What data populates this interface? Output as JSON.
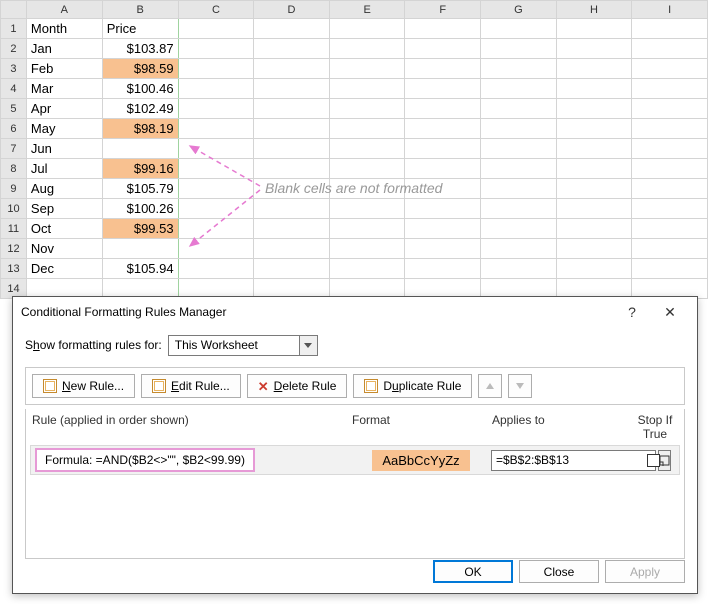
{
  "columns": [
    "A",
    "B",
    "C",
    "D",
    "E",
    "F",
    "G",
    "H",
    "I"
  ],
  "headers": {
    "A": "Month",
    "B": "Price"
  },
  "rows": [
    {
      "n": 1,
      "A": "Month",
      "B": "Price",
      "bold": true,
      "isHeader": true
    },
    {
      "n": 2,
      "A": "Jan",
      "B": "$103.87"
    },
    {
      "n": 3,
      "A": "Feb",
      "B": "$98.59",
      "hl": true
    },
    {
      "n": 4,
      "A": "Mar",
      "B": "$100.46"
    },
    {
      "n": 5,
      "A": "Apr",
      "B": "$102.49"
    },
    {
      "n": 6,
      "A": "May",
      "B": "$98.19",
      "hl": true
    },
    {
      "n": 7,
      "A": "Jun",
      "B": ""
    },
    {
      "n": 8,
      "A": "Jul",
      "B": "$99.16",
      "hl": true
    },
    {
      "n": 9,
      "A": "Aug",
      "B": "$105.79"
    },
    {
      "n": 10,
      "A": "Sep",
      "B": "$100.26"
    },
    {
      "n": 11,
      "A": "Oct",
      "B": "$99.53",
      "hl": true
    },
    {
      "n": 12,
      "A": "Nov",
      "B": ""
    },
    {
      "n": 13,
      "A": "Dec",
      "B": "$105.94"
    },
    {
      "n": 14,
      "A": "",
      "B": ""
    }
  ],
  "annotation": "Blank cells are not formatted",
  "dialog": {
    "title": "Conditional Formatting Rules Manager",
    "help": "?",
    "close": "✕",
    "show_label_pre": "S",
    "show_label_u": "h",
    "show_label_post": "ow formatting rules for:",
    "scope": "This Worksheet",
    "buttons": {
      "new_u": "N",
      "new_rest": "ew Rule...",
      "edit_u": "E",
      "edit_rest": "dit Rule...",
      "delete_u": "D",
      "delete_rest": "elete Rule",
      "dup_pre": "D",
      "dup_u": "u",
      "dup_rest": "plicate Rule"
    },
    "headers": {
      "rule": "Rule (applied in order shown)",
      "format": "Format",
      "applies": "Applies to",
      "stop": "Stop If True"
    },
    "rule": {
      "formula_label": "Formula: =AND($B2<>\"\", $B2<99.99)",
      "preview": "AaBbCcYyZz",
      "range": "=$B$2:$B$13"
    },
    "footer": {
      "ok": "OK",
      "close": "Close",
      "apply": "Apply"
    }
  }
}
